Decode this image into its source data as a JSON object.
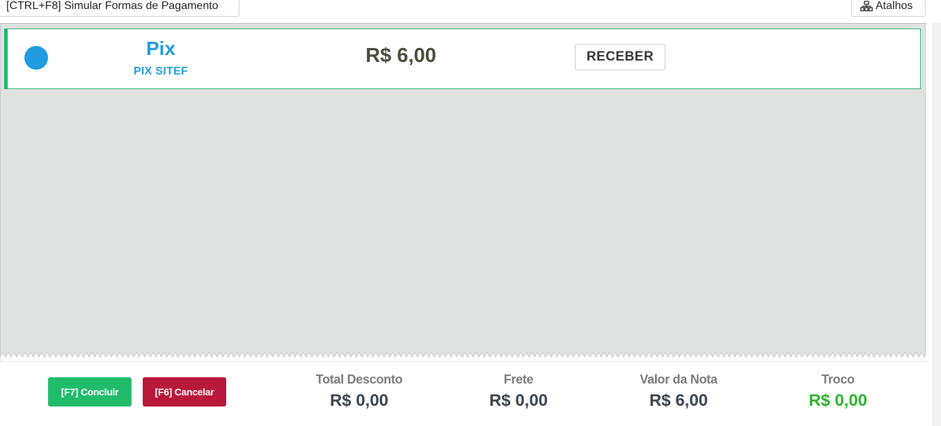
{
  "toolbar": {
    "simular_label": "[CTRL+F8] Simular Formas de Pagamento",
    "atalhos_label": "Atalhos"
  },
  "payment": {
    "method": "Pix",
    "provider": "PIX SITEF",
    "value": "R$ 6,00",
    "receive_label": "RECEBER"
  },
  "actions": {
    "concluir_label": "[F7] Concluir",
    "cancelar_label": "[F6] Cancelar"
  },
  "summary": {
    "total_desconto_label": "Total Desconto",
    "total_desconto_value": "R$ 0,00",
    "frete_label": "Frete",
    "frete_value": "R$ 0,00",
    "valor_nota_label": "Valor da Nota",
    "valor_nota_value": "R$ 6,00",
    "troco_label": "Troco",
    "troco_value": "R$ 0,00"
  },
  "colors": {
    "pix_blue": "#1f9be0",
    "success_green": "#21bb6c",
    "danger_red": "#b8183a",
    "troco_green": "#2ab42d"
  },
  "icons": {
    "atalhos": "sitemap-icon",
    "payment_status": "status-dot-icon"
  }
}
